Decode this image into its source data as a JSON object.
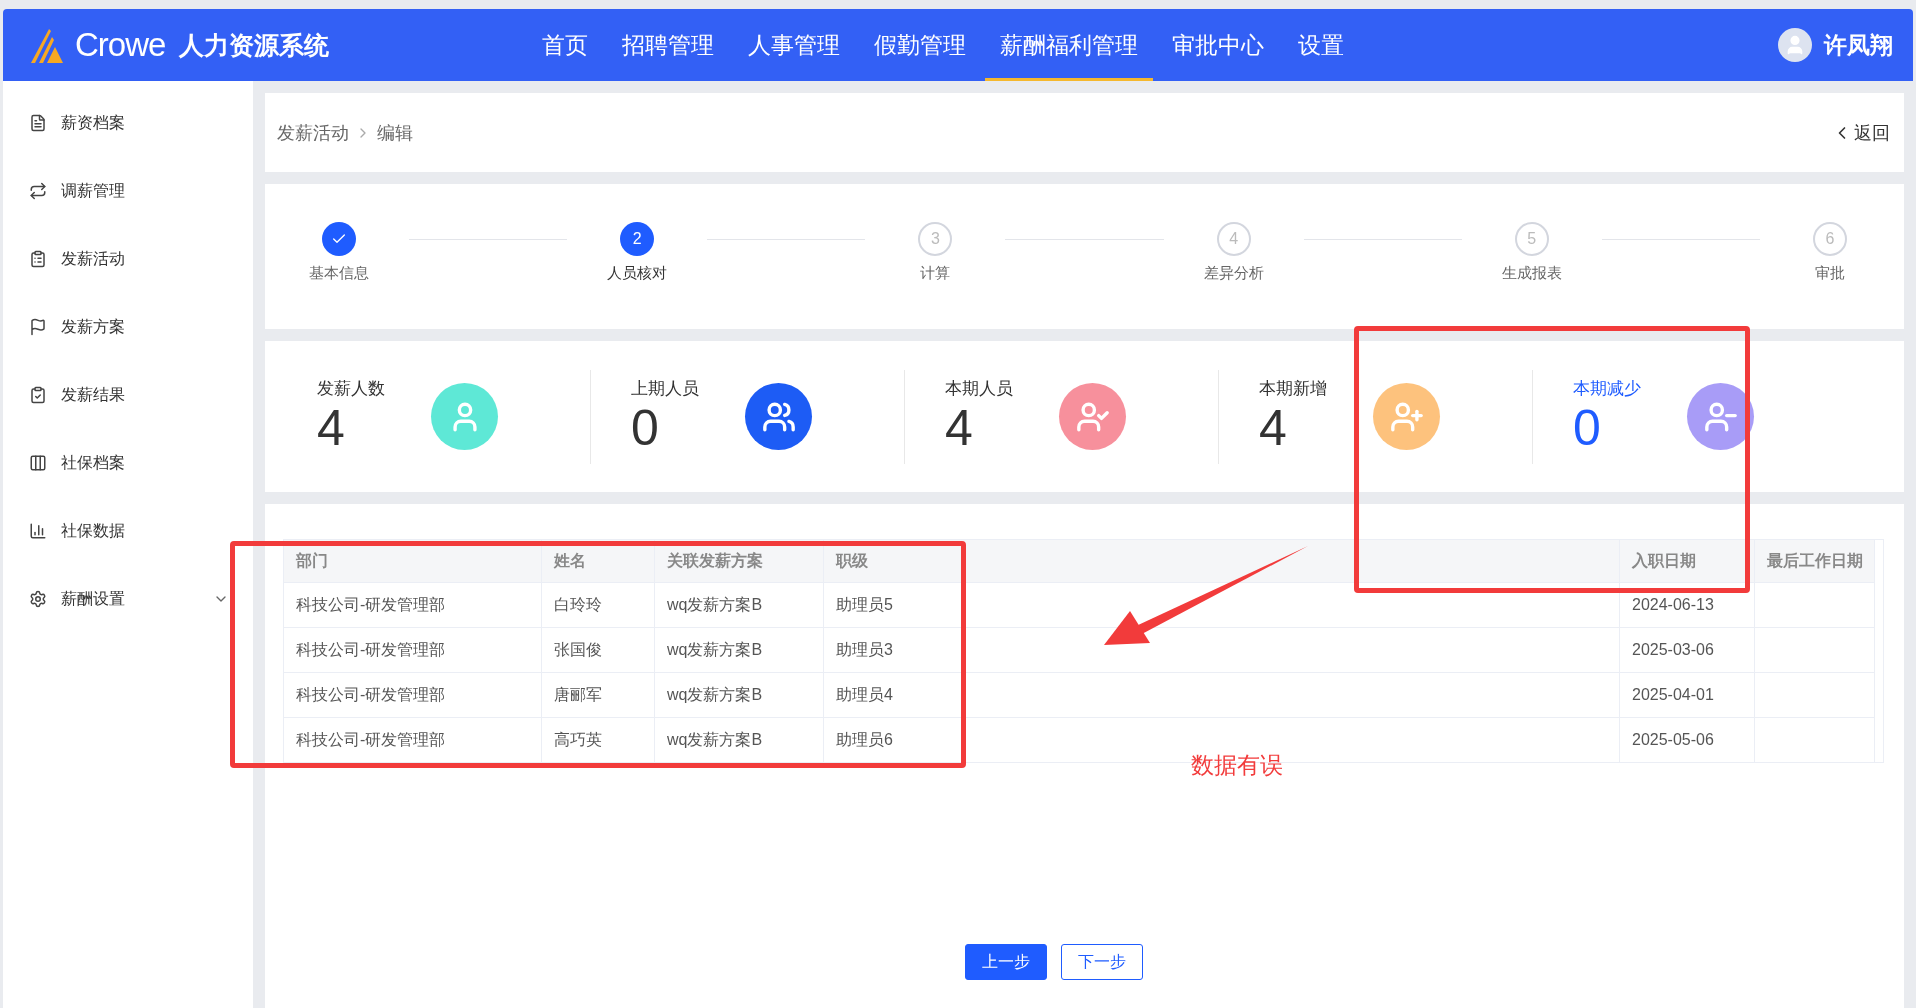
{
  "header": {
    "logo_text": "Crowe",
    "system_name": "人力资源系统",
    "user_name": "许凤翔"
  },
  "nav": [
    {
      "label": "首页",
      "selected": false
    },
    {
      "label": "招聘管理",
      "selected": false
    },
    {
      "label": "人事管理",
      "selected": false
    },
    {
      "label": "假勤管理",
      "selected": false
    },
    {
      "label": "薪酬福利管理",
      "selected": true
    },
    {
      "label": "审批中心",
      "selected": false
    },
    {
      "label": "设置",
      "selected": false
    }
  ],
  "sidebar": {
    "items": [
      {
        "label": "薪资档案",
        "kind": "link"
      },
      {
        "label": "调薪管理",
        "kind": "link"
      },
      {
        "label": "发薪活动",
        "kind": "link"
      },
      {
        "label": "发薪方案",
        "kind": "link"
      },
      {
        "label": "发薪结果",
        "kind": "link"
      },
      {
        "label": "社保档案",
        "kind": "link"
      },
      {
        "label": "社保数据",
        "kind": "link"
      },
      {
        "label": "薪酬设置",
        "kind": "group"
      }
    ]
  },
  "breadcrumb": [
    "发薪活动",
    "编辑"
  ],
  "back_label": "返回",
  "steps": [
    {
      "label": "基本信息",
      "completed": true,
      "selected": false
    },
    {
      "label": "人员核对",
      "completed": false,
      "selected": true,
      "number": "2"
    },
    {
      "label": "计算",
      "completed": false,
      "selected": false,
      "number": "3"
    },
    {
      "label": "差异分析",
      "completed": false,
      "selected": false,
      "number": "4"
    },
    {
      "label": "生成报表",
      "completed": false,
      "selected": false,
      "number": "5"
    },
    {
      "label": "审批",
      "completed": false,
      "selected": false,
      "number": "6"
    }
  ],
  "stats": [
    {
      "label": "发薪人数",
      "value": "4",
      "kind": "pay",
      "color": "#5ee8d6",
      "active": false
    },
    {
      "label": "上期人员",
      "value": "0",
      "kind": "group",
      "color": "#1d5cf5",
      "active": false
    },
    {
      "label": "本期人员",
      "value": "4",
      "kind": "check",
      "color": "#f7909c",
      "active": false
    },
    {
      "label": "本期新增",
      "value": "4",
      "kind": "add",
      "color": "#fdc27d",
      "active": false
    },
    {
      "label": "本期减少",
      "value": "0",
      "kind": "remove",
      "color": "#a89cf7",
      "active": true
    }
  ],
  "table": {
    "columns": [
      "部门",
      "姓名",
      "关联发薪方案",
      "职级",
      "入职日期",
      "最后工作日期"
    ],
    "rows": [
      [
        "科技公司-研发管理部",
        "白玲玲",
        "wq发薪方案B",
        "助理员5",
        "2024-06-13"
      ],
      [
        "科技公司-研发管理部",
        "张国俊",
        "wq发薪方案B",
        "助理员3",
        "2025-03-06"
      ],
      [
        "科技公司-研发管理部",
        "唐郦军",
        "wq发薪方案B",
        "助理员4",
        "2025-04-01"
      ],
      [
        "科技公司-研发管理部",
        "高巧英",
        "wq发薪方案B",
        "助理员6",
        "2025-05-06"
      ]
    ]
  },
  "buttons": [
    {
      "label": "上一步",
      "kind": "primary"
    },
    {
      "label": "下一步",
      "kind": "secondary"
    }
  ],
  "annotation": {
    "note": "数据有误"
  }
}
